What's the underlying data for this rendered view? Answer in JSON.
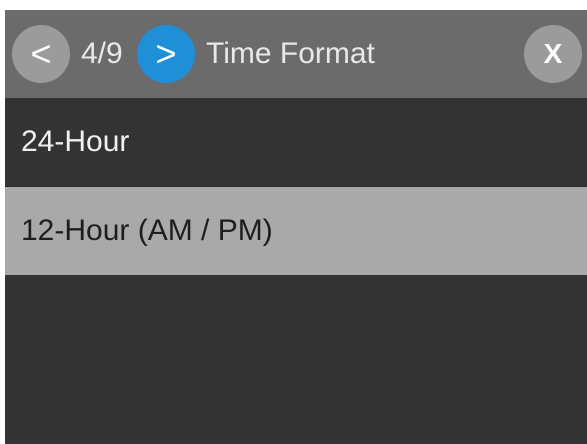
{
  "header": {
    "prev_label": "<",
    "page_indicator": "4/9",
    "next_label": ">",
    "title": "Time Format",
    "close_label": "X"
  },
  "options": [
    {
      "label": "24-Hour",
      "selected": false
    },
    {
      "label": "12-Hour (AM / PM)",
      "selected": true
    }
  ],
  "colors": {
    "header_bg": "#6b6b6b",
    "screen_bg": "#333333",
    "selected_bg": "#a9a9a9",
    "accent": "#1f8fd8",
    "button_gray": "#9b9b9b"
  }
}
